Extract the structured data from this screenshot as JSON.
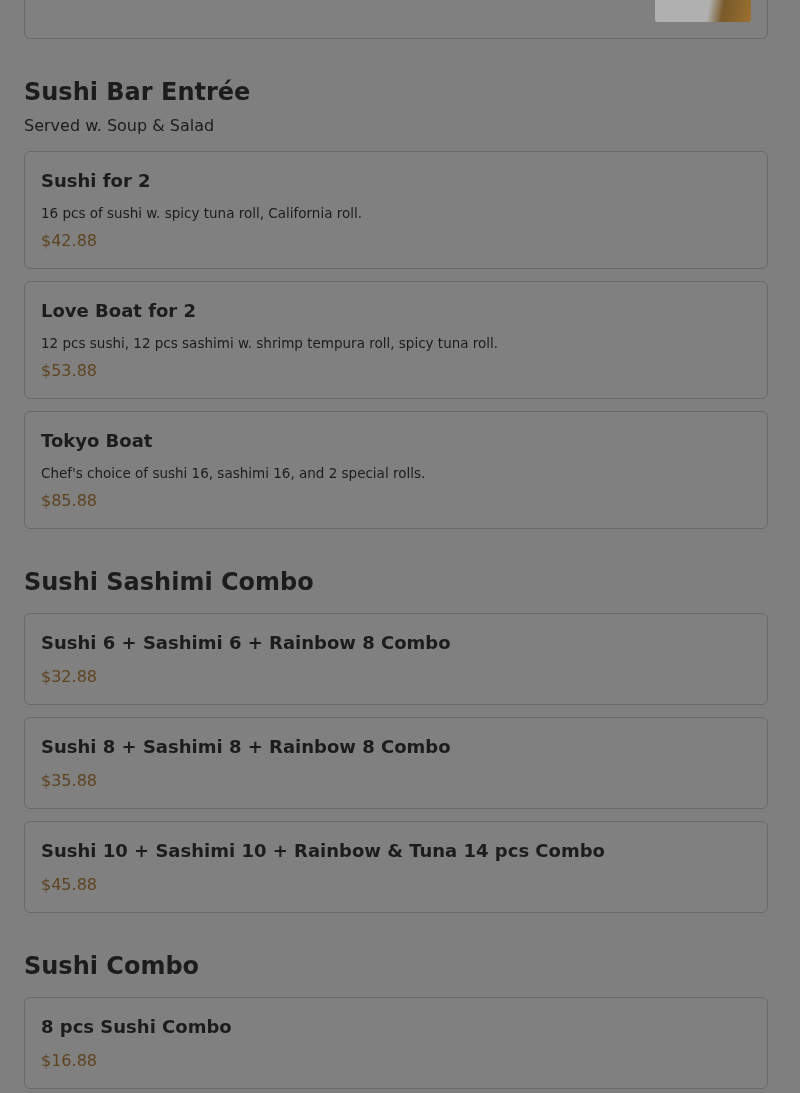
{
  "sections": [
    {
      "title": "Sushi Bar Entrée",
      "subtitle": "Served w. Soup & Salad",
      "items": [
        {
          "name": "Sushi for 2",
          "description": "16 pcs of sushi w. spicy tuna roll, California roll.",
          "price": "$42.88"
        },
        {
          "name": "Love Boat for 2",
          "description": "12 pcs sushi, 12 pcs sashimi w. shrimp tempura roll, spicy tuna roll.",
          "price": "$53.88"
        },
        {
          "name": "Tokyo Boat",
          "description": "Chef's choice of sushi 16, sashimi 16, and 2 special rolls.",
          "price": "$85.88"
        }
      ]
    },
    {
      "title": "Sushi Sashimi Combo",
      "items": [
        {
          "name": "Sushi 6 + Sashimi 6 + Rainbow 8 Combo",
          "price": "$32.88"
        },
        {
          "name": "Sushi 8 + Sashimi 8 + Rainbow 8 Combo",
          "price": "$35.88"
        },
        {
          "name": "Sushi 10 + Sashimi 10 + Rainbow & Tuna 14 pcs Combo",
          "price": "$45.88"
        }
      ]
    },
    {
      "title": "Sushi Combo",
      "items": [
        {
          "name": "8 pcs Sushi Combo",
          "price": "$16.88"
        }
      ]
    }
  ]
}
